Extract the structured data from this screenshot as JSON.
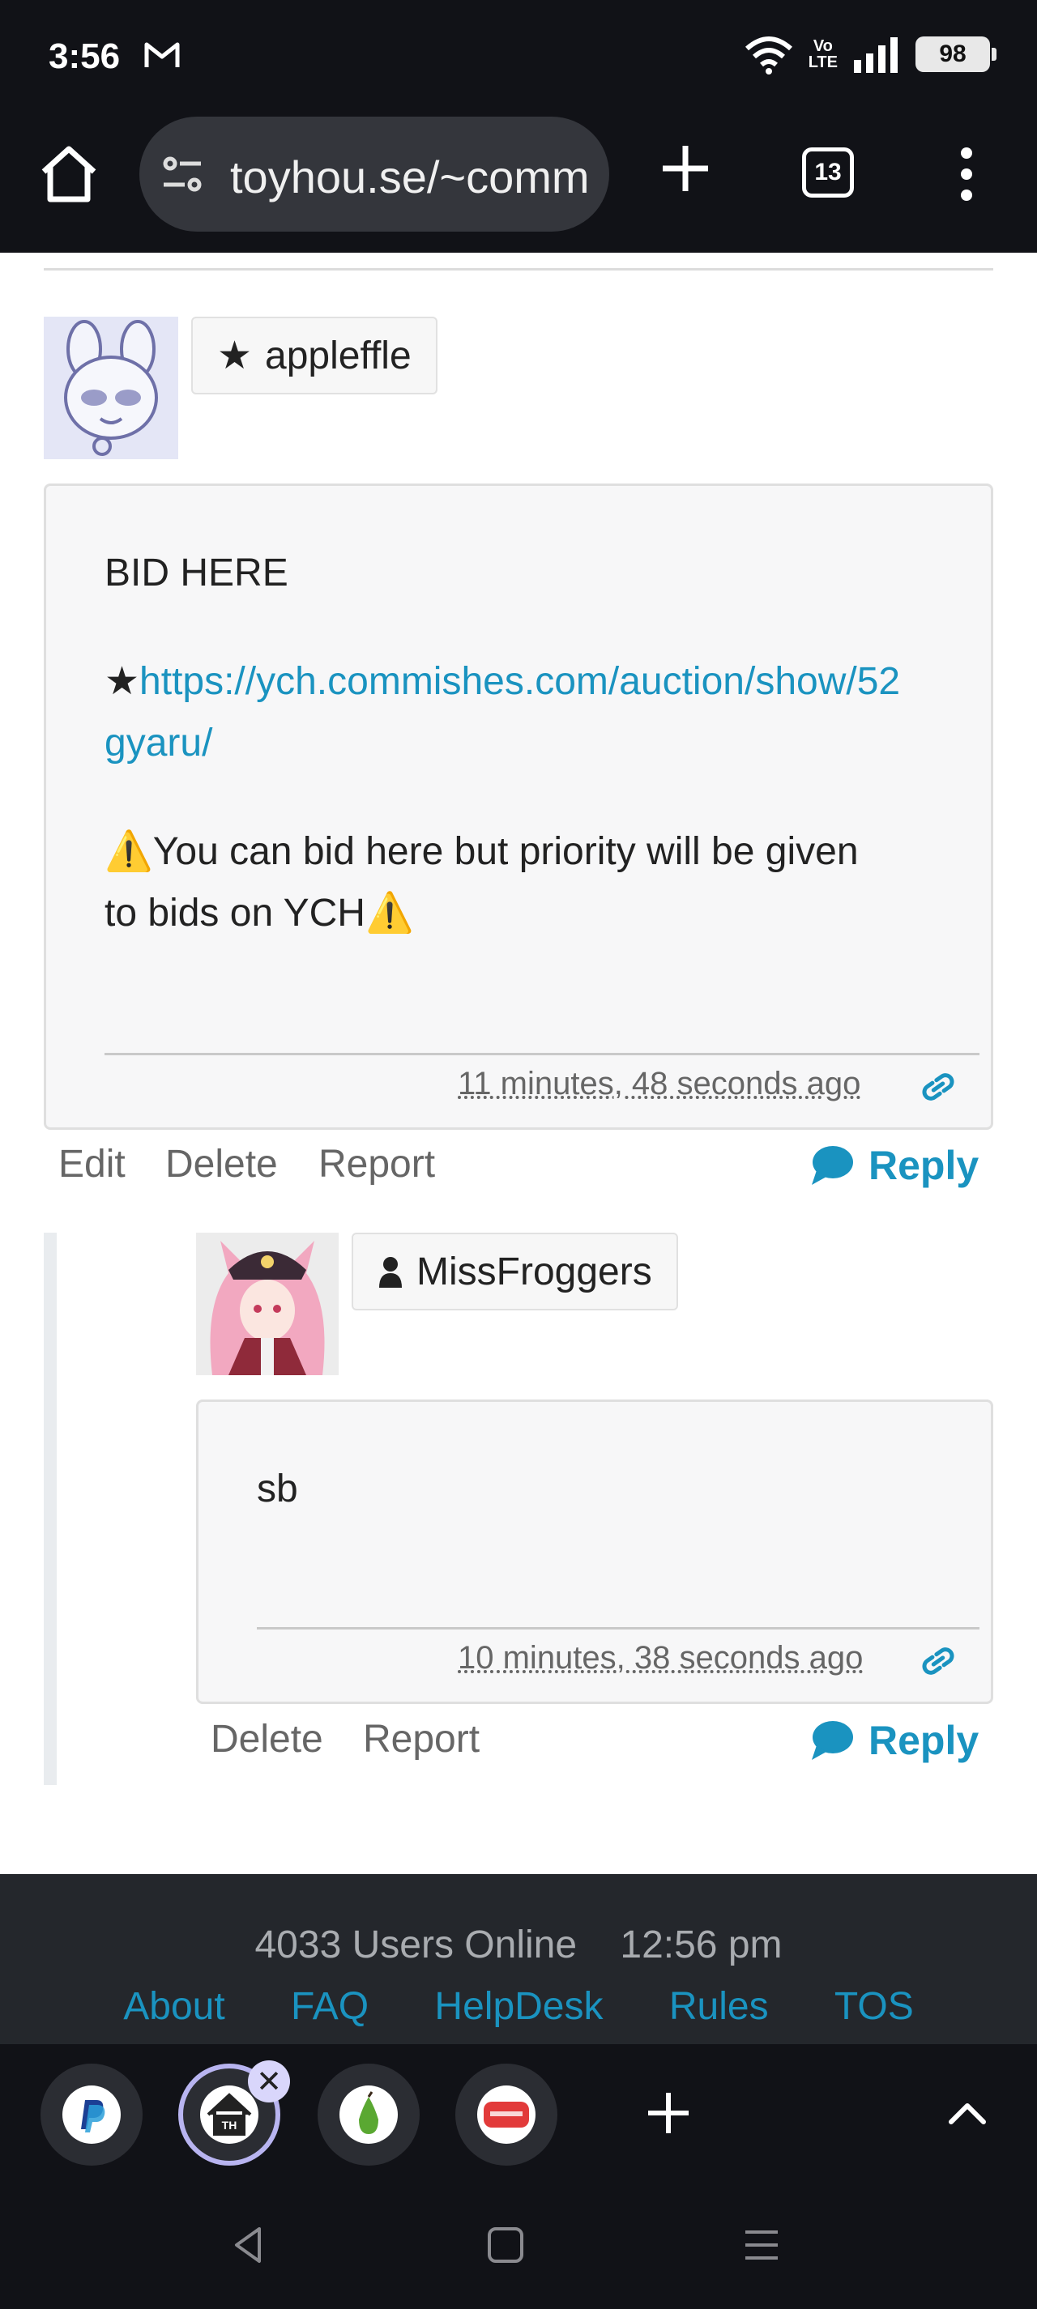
{
  "status_bar": {
    "time": "3:56",
    "volte_top": "Vo",
    "volte_bottom": "LTE",
    "battery": "98"
  },
  "browser": {
    "url": "toyhou.se/~comm",
    "tab_count": "13"
  },
  "comments": [
    {
      "username": "appleffle",
      "user_icon": "star-icon",
      "body_line1": "BID HERE",
      "link_prefix": "★",
      "link_line1": "https://ych.commishes.com/auction/show/52",
      "link_line2": "gyaru/",
      "warning_line1": "⚠️You can bid here but priority will be given",
      "warning_line2": "to bids on YCH⚠️",
      "timestamp": "11 minutes, 48 seconds ago",
      "actions": [
        "Edit",
        "Delete",
        "Report"
      ],
      "reply_label": "Reply"
    },
    {
      "username": "MissFroggers",
      "user_icon": "user-icon",
      "body": "sb",
      "timestamp": "10 minutes, 38 seconds ago",
      "actions": [
        "Delete",
        "Report"
      ],
      "reply_label": "Reply"
    }
  ],
  "footer": {
    "users_online": "4033 Users Online",
    "time": "12:56 pm",
    "links": [
      "About",
      "FAQ",
      "HelpDesk",
      "Rules",
      "TOS"
    ]
  },
  "colors": {
    "link": "#1a93c0",
    "chrome_dark": "#111217",
    "footer_bg": "#24272c"
  }
}
